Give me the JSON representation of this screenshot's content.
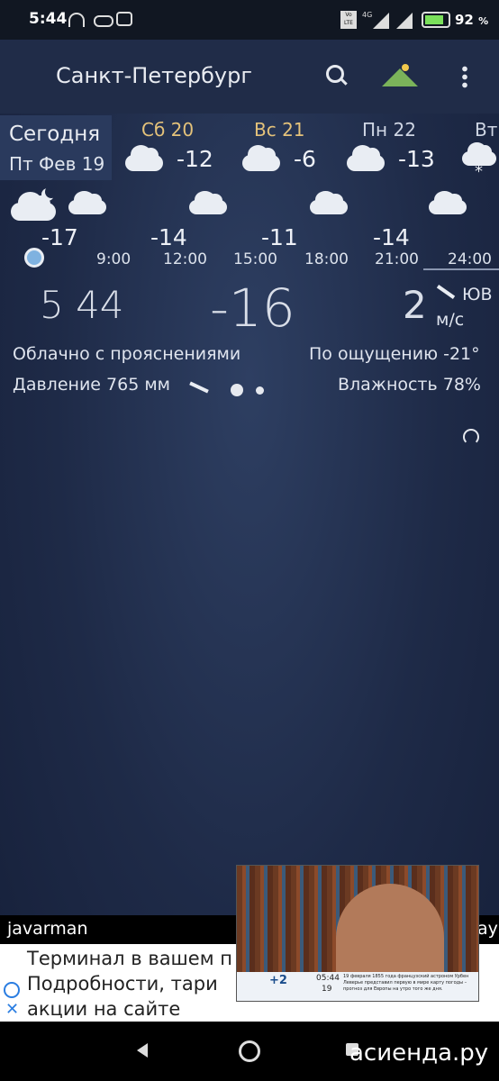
{
  "status": {
    "time": "5:44",
    "battery_pct": "92",
    "battery_pct_sign": "%",
    "lte_badge_top": "Vo",
    "lte_badge_bottom": "LTE",
    "net_label": "4G"
  },
  "header": {
    "city": "Санкт-Петербург"
  },
  "today": {
    "label": "Сегодня",
    "date": "Пт Фев 19"
  },
  "days": [
    {
      "name": "Сб 20",
      "temp": "-12",
      "icon": "cloud-icon"
    },
    {
      "name": "Вс 21",
      "temp": "-6",
      "icon": "cloud-icon"
    },
    {
      "name": "Пн 22",
      "temp": "-13",
      "icon": "cloud-icon"
    },
    {
      "name": "Вт",
      "temp": "",
      "icon": "snow-cloud-icon"
    }
  ],
  "hourly": {
    "temps": [
      "-17",
      "-14",
      "-11",
      "-14"
    ],
    "hours": [
      "9:00",
      "12:00",
      "15:00",
      "18:00",
      "21:00",
      "24:00"
    ]
  },
  "current": {
    "time": "5 44",
    "temp": "-16",
    "wind_speed": "2",
    "wind_unit": "м/с",
    "wind_dir": "ЮВ",
    "condition": "Облачно с прояснениями",
    "feels_like": "По ощущению -21°",
    "pressure": "Давление 765 мм",
    "humidity": "Влажность 78%"
  },
  "ad": {
    "author": "javarman",
    "author_right": "ay",
    "line1": "Терминал в вашем п",
    "line2": "Подробности, тари",
    "line3": "акции на сайте",
    "watermark": "асиенда.ру"
  },
  "tv": {
    "temp": "+2",
    "time": "05:44",
    "date": "19",
    "ticker": "19 февраля 1855 года французский астроном Урбен Леверье представил первую в мире карту погоды – прогноз для Европы на утро того же дня."
  }
}
